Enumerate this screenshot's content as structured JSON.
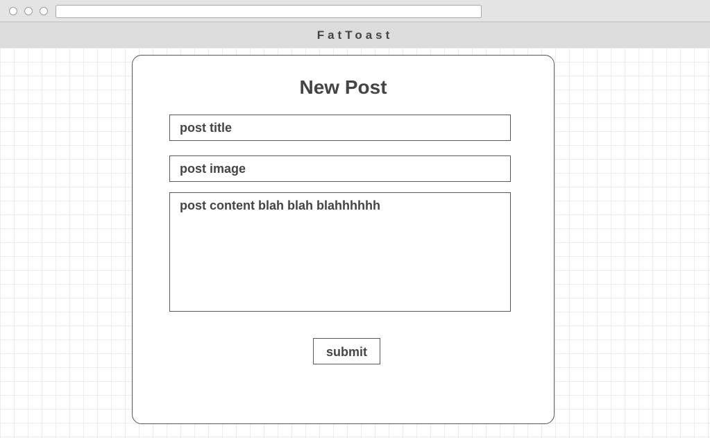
{
  "site": {
    "name": "FatToast"
  },
  "form": {
    "heading": "New Post",
    "title_value": "post title",
    "image_value": "post image",
    "content_value": "post content blah blah blahhhhhh",
    "submit_label": "submit"
  },
  "colors": {
    "text": "#444444",
    "header_bg": "#dcdcdc",
    "chrome_bg": "#e4e4e4",
    "border": "#555555",
    "grid_line": "#ebebeb"
  }
}
